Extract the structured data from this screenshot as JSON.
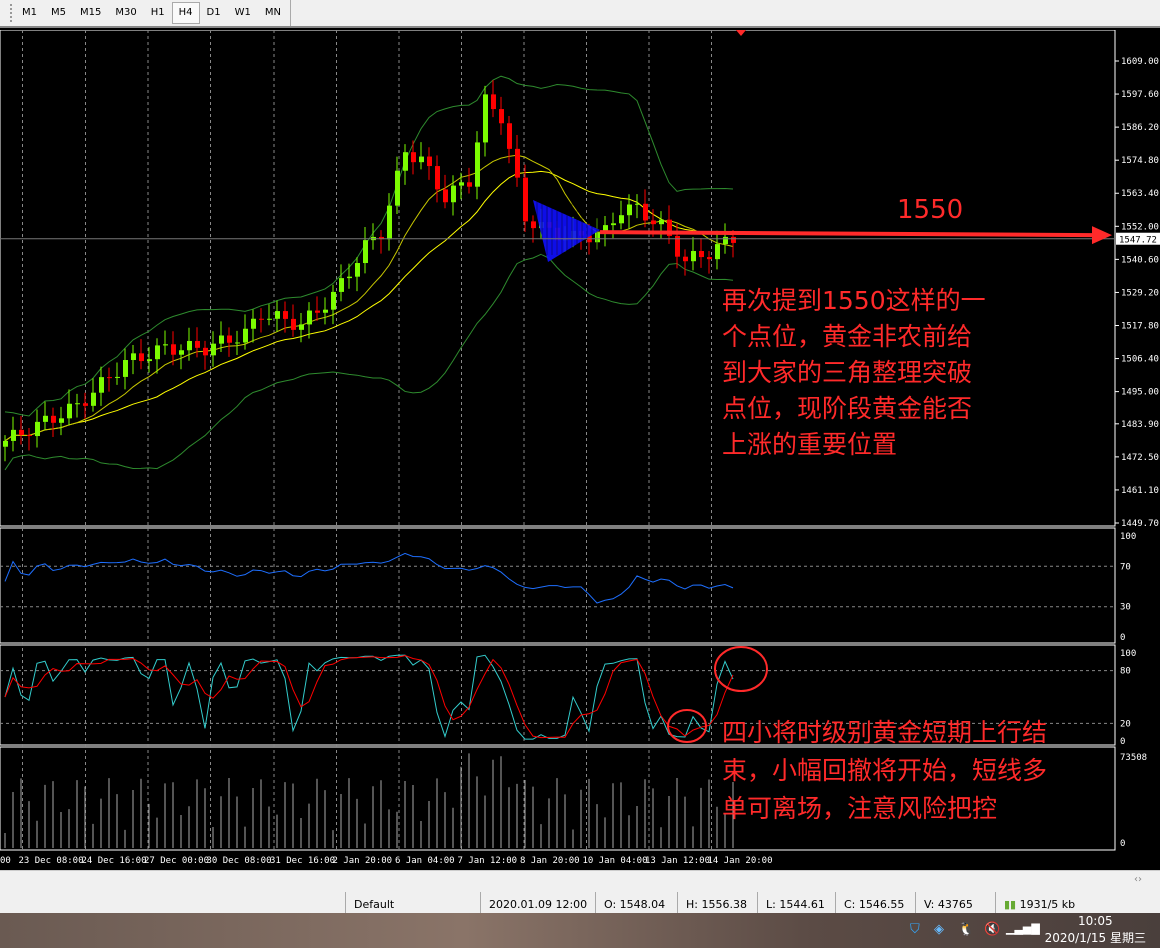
{
  "toolbar": {
    "timeframes": [
      "M1",
      "M5",
      "M15",
      "M30",
      "H1",
      "H4",
      "D1",
      "W1",
      "MN"
    ],
    "active": "H4"
  },
  "chart": {
    "price_ticks": [
      "1609.00",
      "1597.60",
      "1586.20",
      "1574.80",
      "1563.40",
      "1552.00",
      "1540.60",
      "1529.20",
      "1517.80",
      "1506.40",
      "1495.00",
      "1483.90",
      "1472.50",
      "1461.10",
      "1449.70"
    ],
    "current_price": "1547.72",
    "time_labels": [
      "00",
      "23 Dec 08:00",
      "24 Dec 16:00",
      "27 Dec 00:00",
      "30 Dec 08:00",
      "31 Dec 16:00",
      "2 Jan 20:00",
      "6 Jan 04:00",
      "7 Jan 12:00",
      "8 Jan 20:00",
      "10 Jan 04:00",
      "13 Jan 12:00",
      "14 Jan 20:00"
    ],
    "rsi_ticks": [
      "100",
      "70",
      "30",
      "0"
    ],
    "stoch_ticks": [
      "100",
      "80",
      "20",
      "0"
    ],
    "volume_ticks": [
      "73508",
      "0"
    ],
    "level_label": "1550",
    "colors": {
      "bull": "#7cfc00",
      "bear": "#ff0000",
      "bands": "#2e8b2e",
      "ma": "#ffff00",
      "rsi": "#1e6fff",
      "annotation": "#ff2a2a",
      "triangle": "#1010ff"
    }
  },
  "chart_data": {
    "type": "candlestick",
    "symbol_timeframe": "H4",
    "ylim": [
      1449.7,
      1609
    ],
    "close_keypoints": [
      [
        0,
        1478
      ],
      [
        9,
        1490
      ],
      [
        15,
        1505
      ],
      [
        20,
        1510
      ],
      [
        25,
        1510
      ],
      [
        30,
        1515
      ],
      [
        32,
        1522
      ],
      [
        37,
        1518
      ],
      [
        41,
        1528
      ],
      [
        45,
        1545
      ],
      [
        47,
        1550
      ],
      [
        50,
        1578
      ],
      [
        52,
        1575
      ],
      [
        55,
        1562
      ],
      [
        58,
        1568
      ],
      [
        60,
        1595
      ],
      [
        62,
        1590
      ],
      [
        63,
        1578
      ],
      [
        65,
        1555
      ],
      [
        68,
        1550
      ],
      [
        71,
        1548
      ],
      [
        75,
        1550
      ],
      [
        77,
        1558
      ],
      [
        79,
        1558
      ],
      [
        82,
        1552
      ],
      [
        85,
        1540
      ],
      [
        88,
        1543
      ],
      [
        91,
        1548
      ]
    ]
  },
  "annotations": {
    "note1": [
      "再次提到1550这样的一",
      "个点位，黄金非农前给",
      "到大家的三角整理突破",
      "点位，现阶段黄金能否",
      "上涨的重要位置"
    ],
    "note2": [
      "四小将时级别黄金短期上行结",
      "束，小幅回撤将开始，短线多",
      "单可离场，注意风险把控"
    ]
  },
  "status": {
    "profile": "Default",
    "time": "2020.01.09 12:00",
    "open": "O: 1548.04",
    "high": "H: 1556.38",
    "low": "L: 1544.61",
    "close": "C: 1546.55",
    "volume": "V: 43765",
    "traffic": "1931/5 kb"
  },
  "taskbar": {
    "time": "10:05",
    "date": "2020/1/15 星期三"
  }
}
